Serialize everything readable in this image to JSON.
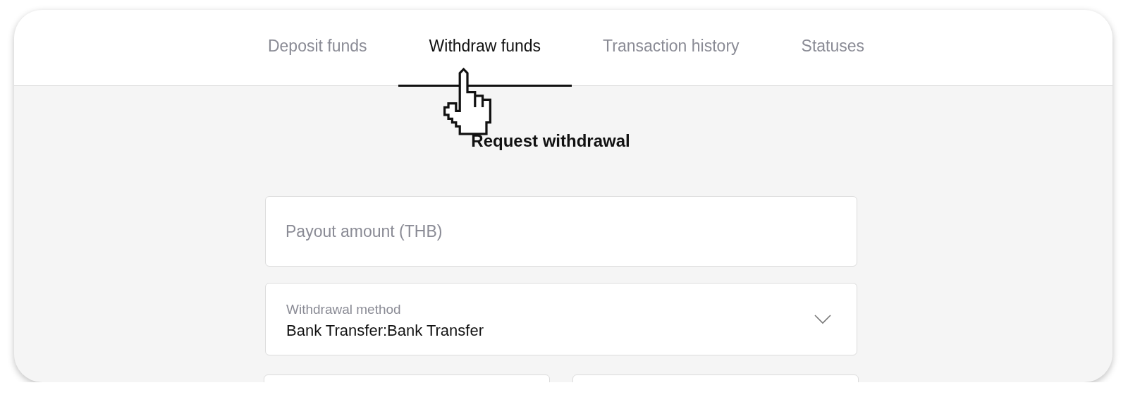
{
  "tabs": [
    {
      "label": "Deposit funds",
      "selected": false
    },
    {
      "label": "Withdraw funds",
      "selected": true
    },
    {
      "label": "Transaction history",
      "selected": false
    },
    {
      "label": "Statuses",
      "selected": false
    }
  ],
  "form": {
    "title": "Request withdrawal",
    "amount_field": {
      "placeholder": "Payout amount (THB)"
    },
    "method_field": {
      "label": "Withdrawal method",
      "value": "Bank Transfer:Bank Transfer"
    }
  }
}
